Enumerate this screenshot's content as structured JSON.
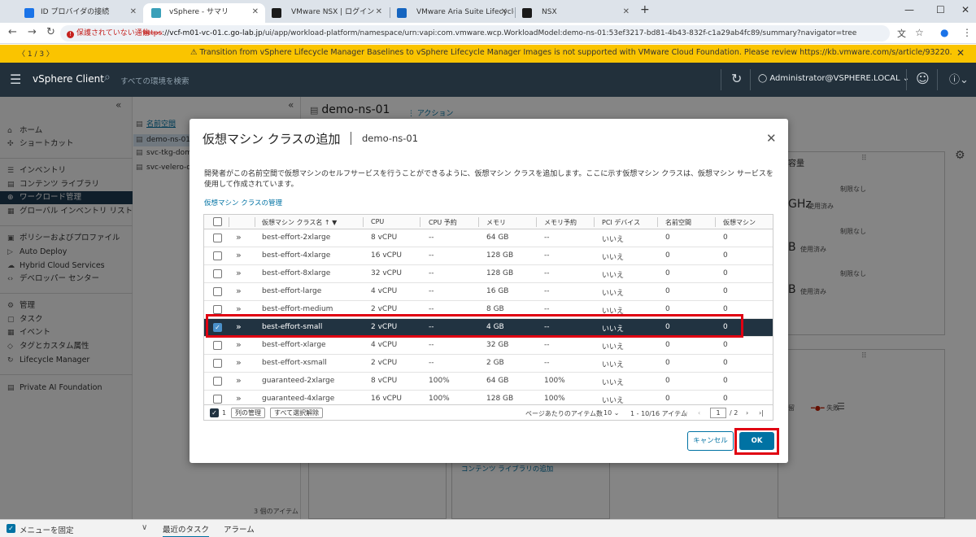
{
  "browser": {
    "tabs": [
      {
        "label": "ID プロバイダの接続",
        "icon": "globe-icon",
        "color": "#1a73e8"
      },
      {
        "label": "vSphere - サマリ",
        "icon": "vsphere-icon",
        "color": "#3aa0b9"
      },
      {
        "label": "VMware NSX | ログイン",
        "icon": "nsx-icon",
        "color": "#1a1a1a"
      },
      {
        "label": "VMware Aria Suite Lifecycle",
        "icon": "aria-icon",
        "color": "#1565c0"
      },
      {
        "label": "NSX",
        "icon": "nsx-icon",
        "color": "#1a1a1a"
      }
    ],
    "new_tab": "+",
    "window_controls": {
      "minimize": "—",
      "maximize": "☐",
      "close": "✕"
    },
    "insecure_label": "保護されていない通信",
    "url_scheme": "https",
    "url_host": "://vcf-m01-vc-01.c.go-lab.jp",
    "url_path": "/ui/app/workload-platform/namespace/urn:vapi:com.vmware.wcp.WorkloadModel:demo-ns-01:53ef3217-bd81-4b43-832f-c1a29ab4fc89/summary?navigator=tree"
  },
  "banner": {
    "pager": "〈  1 / 3  〉",
    "message": "⚠  Transition from vSphere Lifecycle Manager Baselines to vSphere Lifecycle Manager Images is not supported with VMware Cloud Foundation. Please review https://kb.vmware.com/s/article/93220.",
    "close": "✕",
    "color": "#fac400"
  },
  "header": {
    "app_title": "vSphere Client",
    "search_placeholder": "すべての環境を検索",
    "user": "Administrator@VSPHERE.LOCAL",
    "color": "#22303b"
  },
  "leftnav": {
    "collapse": "«",
    "items": [
      {
        "label": "ホーム",
        "icon": "⌂"
      },
      {
        "label": "ショートカット",
        "icon": "✣"
      },
      {
        "label": "インベントリ",
        "icon": "☰"
      },
      {
        "label": "コンテンツ ライブラリ",
        "icon": "▤"
      },
      {
        "label": "ワークロード管理",
        "icon": "⊕",
        "active": true
      },
      {
        "label": "グローバル インベントリ リスト",
        "icon": "▦"
      },
      {
        "label": "ポリシーおよびプロファイル",
        "icon": "▣"
      },
      {
        "label": "Auto Deploy",
        "icon": "▷"
      },
      {
        "label": "Hybrid Cloud Services",
        "icon": "☁"
      },
      {
        "label": "デベロッパー センター",
        "icon": "‹›"
      },
      {
        "label": "管理",
        "icon": "⚙"
      },
      {
        "label": "タスク",
        "icon": "▢"
      },
      {
        "label": "イベント",
        "icon": "▦"
      },
      {
        "label": "タグとカスタム属性",
        "icon": "◇"
      },
      {
        "label": "Lifecycle Manager",
        "icon": "↻"
      },
      {
        "label": "Private AI Foundation",
        "icon": "▤"
      }
    ]
  },
  "tree": {
    "collapse": "«",
    "root": "名前空間",
    "items": [
      "demo-ns-01",
      "svc-tkg-domain-c8",
      "svc-velero-domain-c8"
    ],
    "footer": "3 個のアイテム"
  },
  "content": {
    "title": "demo-ns-01",
    "actions": "⋮ アクション",
    "capacity_title": "容量",
    "no_limit": "制限なし",
    "cpu_value": "GHz",
    "mem_value": "B",
    "storage_value": "B",
    "used": "使用済み",
    "legend_reserved": "保留",
    "legend_failed": "失敗",
    "content_library_link": "コンテンツ ライブラリの追加"
  },
  "bottombar": {
    "pin_menu": "メニューを固定",
    "chevron": "∨",
    "tabs": [
      "最近のタスク",
      "アラーム"
    ]
  },
  "modal": {
    "title": "仮想マシン クラスの追加",
    "subtitle": "demo-ns-01",
    "close": "✕",
    "description": "開発者がこの名前空間で仮想マシンのセルフサービスを行うことができるように、仮想マシン クラスを追加します。ここに示す仮想マシン クラスは、仮想マシン サービスを使用して作成されています。",
    "manage_link": "仮想マシン クラスの管理",
    "columns": [
      "仮想マシン クラス名",
      "CPU",
      "CPU 予約",
      "メモリ",
      "メモリ予約",
      "PCI デバイス",
      "名前空間",
      "仮想マシン"
    ],
    "rows": [
      {
        "name": "best-effort-2xlarge",
        "cpu": "8 vCPU",
        "cpu_res": "--",
        "mem": "64 GB",
        "mem_res": "--",
        "pci": "いいえ",
        "ns": "0",
        "vm": "0",
        "selected": false
      },
      {
        "name": "best-effort-4xlarge",
        "cpu": "16 vCPU",
        "cpu_res": "--",
        "mem": "128 GB",
        "mem_res": "--",
        "pci": "いいえ",
        "ns": "0",
        "vm": "0",
        "selected": false
      },
      {
        "name": "best-effort-8xlarge",
        "cpu": "32 vCPU",
        "cpu_res": "--",
        "mem": "128 GB",
        "mem_res": "--",
        "pci": "いいえ",
        "ns": "0",
        "vm": "0",
        "selected": false
      },
      {
        "name": "best-effort-large",
        "cpu": "4 vCPU",
        "cpu_res": "--",
        "mem": "16 GB",
        "mem_res": "--",
        "pci": "いいえ",
        "ns": "0",
        "vm": "0",
        "selected": false
      },
      {
        "name": "best-effort-medium",
        "cpu": "2 vCPU",
        "cpu_res": "--",
        "mem": "8 GB",
        "mem_res": "--",
        "pci": "いいえ",
        "ns": "0",
        "vm": "0",
        "selected": false
      },
      {
        "name": "best-effort-small",
        "cpu": "2 vCPU",
        "cpu_res": "--",
        "mem": "4 GB",
        "mem_res": "--",
        "pci": "いいえ",
        "ns": "0",
        "vm": "0",
        "selected": true
      },
      {
        "name": "best-effort-xlarge",
        "cpu": "4 vCPU",
        "cpu_res": "--",
        "mem": "32 GB",
        "mem_res": "--",
        "pci": "いいえ",
        "ns": "0",
        "vm": "0",
        "selected": false
      },
      {
        "name": "best-effort-xsmall",
        "cpu": "2 vCPU",
        "cpu_res": "--",
        "mem": "2 GB",
        "mem_res": "--",
        "pci": "いいえ",
        "ns": "0",
        "vm": "0",
        "selected": false
      },
      {
        "name": "guaranteed-2xlarge",
        "cpu": "8 vCPU",
        "cpu_res": "100%",
        "mem": "64 GB",
        "mem_res": "100%",
        "pci": "いいえ",
        "ns": "0",
        "vm": "0",
        "selected": false
      },
      {
        "name": "guaranteed-4xlarge",
        "cpu": "16 vCPU",
        "cpu_res": "100%",
        "mem": "128 GB",
        "mem_res": "100%",
        "pci": "いいえ",
        "ns": "0",
        "vm": "0",
        "selected": false
      }
    ],
    "footer": {
      "selected_count": "1",
      "manage_columns": "列の管理",
      "deselect_all": "すべて選択解除",
      "items_per_page_label": "ページあたりのアイテム数",
      "items_per_page": "10",
      "range": "1 - 10/16 アイテム",
      "current_page": "1",
      "total_pages": "/ 2"
    },
    "cancel": "キャンセル",
    "ok": "OK",
    "highlight_color": "#e00012"
  }
}
